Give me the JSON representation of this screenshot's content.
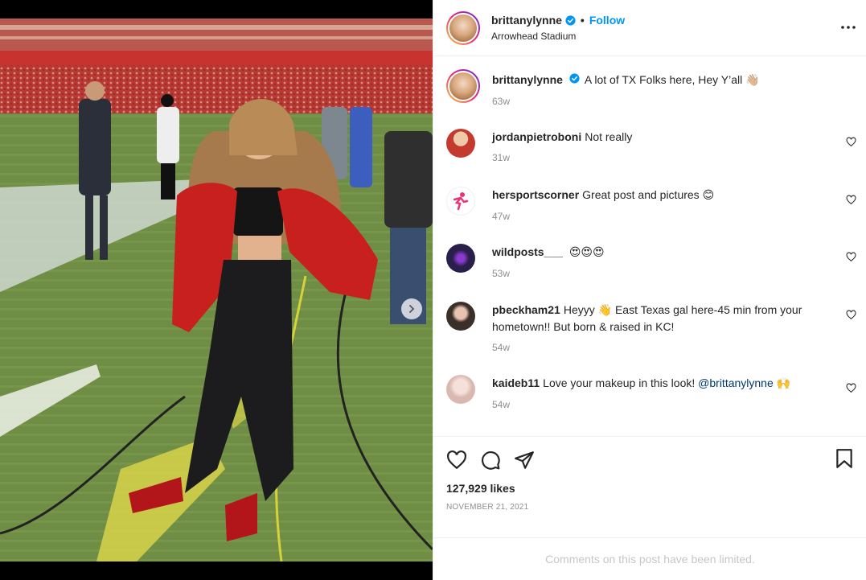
{
  "post": {
    "username": "brittanylynne",
    "follow_label": "Follow",
    "separator": "•",
    "location": "Arrowhead Stadium",
    "caption_text": "A lot of TX Folks here, Hey Y’all",
    "caption_emoji": "👋🏼",
    "caption_time": "63w",
    "likes": "127,929 likes",
    "date": "NOVEMBER 21, 2021",
    "comments_limited": "Comments on this post have been limited.",
    "slides": 4,
    "active_slide": 1
  },
  "comments": [
    {
      "user": "jordanpietroboni",
      "text": "Not really",
      "emoji": "",
      "time": "31w",
      "avatar_color": "#c43a2e"
    },
    {
      "user": "hersportscorner",
      "text": "Great post and pictures",
      "emoji": "😊",
      "time": "47w",
      "avatar_color": "#e8347a"
    },
    {
      "user": "wildposts___",
      "text": "",
      "emoji": "😍😍😍",
      "time": "53w",
      "avatar_color": "#2a1f4a"
    },
    {
      "user": "pbeckham21",
      "text": "Heyyy",
      "emoji": "👋",
      "text2": "East Texas gal here-45 min from your hometown!! But born & raised in KC!",
      "time": "54w",
      "avatar_color": "#3b2f2a"
    },
    {
      "user": "kaideb11",
      "text": "Love your makeup in this look!",
      "mention": "@brittanylynne",
      "emoji": "🙌",
      "time": "54w",
      "avatar_color": "#d9b8b0"
    }
  ],
  "icons": {
    "verified": "verified-badge-icon",
    "more": "more-options-icon",
    "heart": "heart-icon",
    "comment": "comment-icon",
    "share": "share-icon",
    "save": "bookmark-icon",
    "next": "chevron-right-icon"
  },
  "colors": {
    "accent": "#0095f6",
    "verified": "#0095f6",
    "muted": "#8e8e8e"
  }
}
